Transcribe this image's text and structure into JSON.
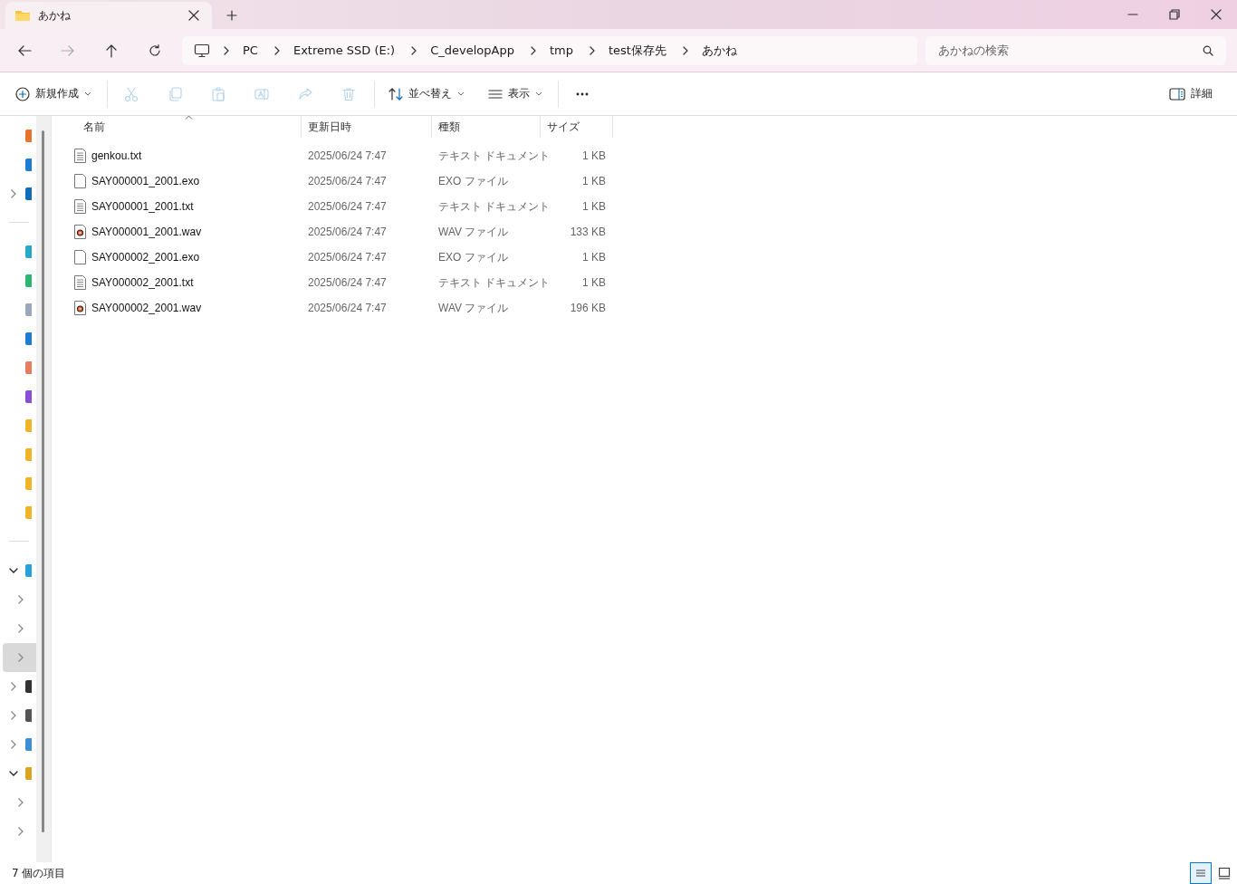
{
  "window": {
    "tab_title": "あかね"
  },
  "address_bar": {
    "segments": [
      "PC",
      "Extreme SSD (E:)",
      "C_developApp",
      "tmp",
      "test保存先",
      "あかね"
    ]
  },
  "search": {
    "placeholder": "あかねの検索"
  },
  "toolbar": {
    "items": [
      {
        "kind": "new",
        "label": "新規作成",
        "disabled": false
      },
      {
        "kind": "cut",
        "disabled": true
      },
      {
        "kind": "copy",
        "disabled": true
      },
      {
        "kind": "paste",
        "disabled": true
      },
      {
        "kind": "rename",
        "disabled": true
      },
      {
        "kind": "share",
        "disabled": true
      },
      {
        "kind": "delete",
        "disabled": true
      },
      {
        "kind": "sort",
        "label": "並べ替え",
        "disabled": false
      },
      {
        "kind": "view",
        "label": "表示",
        "disabled": false
      },
      {
        "kind": "more",
        "disabled": false
      }
    ],
    "details_label": "詳細"
  },
  "sidebar": {
    "items": [
      {
        "kind": "leaf",
        "color": "#e8732c"
      },
      {
        "kind": "leaf",
        "color": "#1a7fd4"
      },
      {
        "kind": "branch",
        "expanded": false,
        "color": "#0f6cbd"
      },
      {
        "kind": "divider"
      },
      {
        "kind": "leaf",
        "color": "#25a9c9"
      },
      {
        "kind": "leaf",
        "color": "#2bb673"
      },
      {
        "kind": "leaf",
        "color": "#9aa7b8"
      },
      {
        "kind": "leaf",
        "color": "#1a7fd4"
      },
      {
        "kind": "leaf",
        "color": "#e87c5f"
      },
      {
        "kind": "leaf",
        "color": "#8a4fd8"
      },
      {
        "kind": "leaf",
        "color": "#f0b429"
      },
      {
        "kind": "leaf",
        "color": "#f0b429"
      },
      {
        "kind": "leaf",
        "color": "#f0b429"
      },
      {
        "kind": "leaf",
        "color": "#f0b429"
      },
      {
        "kind": "divider"
      },
      {
        "kind": "branch",
        "expanded": true,
        "color": "#26a1d9",
        "selected": false,
        "children": [
          {
            "kind": "branch",
            "expanded": false,
            "selected": false
          },
          {
            "kind": "branch",
            "expanded": false,
            "selected": false
          },
          {
            "kind": "branch",
            "expanded": false,
            "selected": true
          }
        ]
      },
      {
        "kind": "branch",
        "expanded": false,
        "color": "#333333"
      },
      {
        "kind": "branch",
        "expanded": false,
        "color": "#555555"
      },
      {
        "kind": "branch",
        "expanded": false,
        "color": "#3a8fd6"
      },
      {
        "kind": "branch",
        "expanded": true,
        "color": "#d9a520",
        "children": [
          {
            "kind": "branch",
            "expanded": false
          },
          {
            "kind": "branch",
            "expanded": false
          }
        ]
      }
    ]
  },
  "table": {
    "columns": [
      {
        "label": "名前",
        "sorted": true
      },
      {
        "label": "更新日時",
        "sorted": false
      },
      {
        "label": "種類",
        "sorted": false
      },
      {
        "label": "サイズ",
        "sorted": false
      }
    ],
    "rows": [
      {
        "kind": "text",
        "name": "genkou.txt",
        "modified": "2025/06/24 7:47",
        "type": "テキスト ドキュメント",
        "size": "1 KB"
      },
      {
        "kind": "blank",
        "name": "SAY000001_2001.exo",
        "modified": "2025/06/24 7:47",
        "type": "EXO ファイル",
        "size": "1 KB"
      },
      {
        "kind": "text",
        "name": "SAY000001_2001.txt",
        "modified": "2025/06/24 7:47",
        "type": "テキスト ドキュメント",
        "size": "1 KB"
      },
      {
        "kind": "audio",
        "name": "SAY000001_2001.wav",
        "modified": "2025/06/24 7:47",
        "type": "WAV ファイル",
        "size": "133 KB"
      },
      {
        "kind": "blank",
        "name": "SAY000002_2001.exo",
        "modified": "2025/06/24 7:47",
        "type": "EXO ファイル",
        "size": "1 KB"
      },
      {
        "kind": "text",
        "name": "SAY000002_2001.txt",
        "modified": "2025/06/24 7:47",
        "type": "テキスト ドキュメント",
        "size": "1 KB"
      },
      {
        "kind": "audio",
        "name": "SAY000002_2001.wav",
        "modified": "2025/06/24 7:47",
        "type": "WAV ファイル",
        "size": "196 KB"
      }
    ]
  },
  "status_bar": {
    "item_count": "7 個の項目",
    "view_buttons": [
      {
        "kind": "details",
        "selected": true
      },
      {
        "kind": "tiles",
        "selected": false
      }
    ]
  }
}
